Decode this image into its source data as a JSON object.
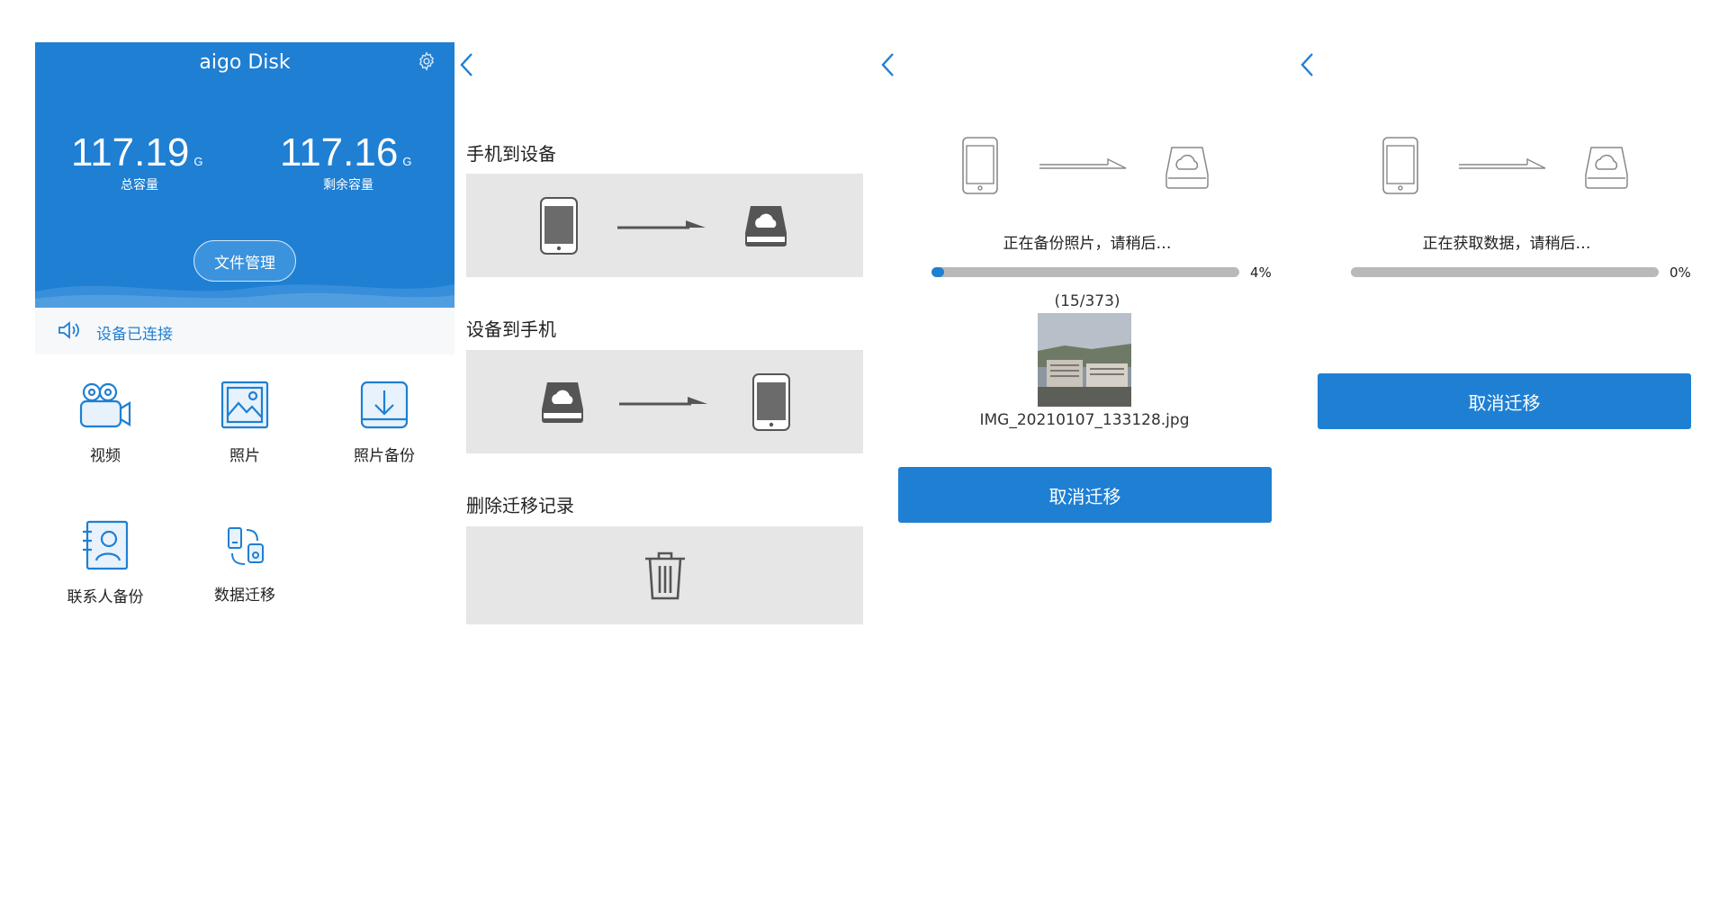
{
  "home": {
    "title": "aigo Disk",
    "total": {
      "value": "117.19",
      "unit": "G",
      "label": "总容量"
    },
    "free": {
      "value": "117.16",
      "unit": "G",
      "label": "剩余容量"
    },
    "file_button": "文件管理",
    "status": "设备已连接",
    "tiles": [
      {
        "label": "视频",
        "icon": "video-camera-icon"
      },
      {
        "label": "照片",
        "icon": "photo-icon"
      },
      {
        "label": "照片备份",
        "icon": "download-icon"
      },
      {
        "label": "联系人备份",
        "icon": "contacts-icon"
      },
      {
        "label": "数据迁移",
        "icon": "data-migration-icon"
      }
    ],
    "accent": "#1f7fd3"
  },
  "migrate_menu": {
    "sections": [
      {
        "title": "手机到设备"
      },
      {
        "title": "设备到手机"
      },
      {
        "title": "删除迁移记录"
      }
    ]
  },
  "backup_progress": {
    "status": "正在备份照片，请稍后…",
    "progress_percent": 4,
    "progress_text": "4%",
    "count": "(15/373)",
    "filename": "IMG_20210107_133128.jpg",
    "cancel_button": "取消迁移"
  },
  "fetch_progress": {
    "status": "正在获取数据，请稍后…",
    "progress_percent": 0,
    "progress_text": "0%",
    "cancel_button": "取消迁移"
  }
}
